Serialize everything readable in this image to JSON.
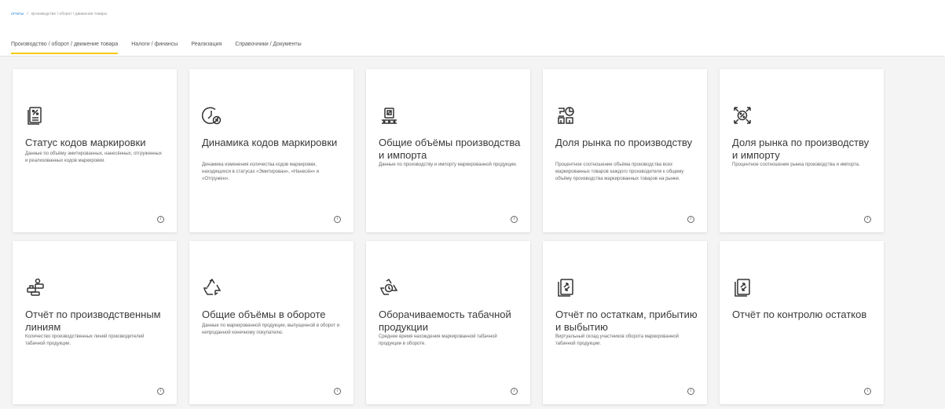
{
  "breadcrumb": {
    "root": "отчеты",
    "separator": "/",
    "path": "производство / оборот / движение товара"
  },
  "tabs": [
    {
      "label": "Производство / оборот / движение товара",
      "active": true
    },
    {
      "label": "Налоги / финансы",
      "active": false
    },
    {
      "label": "Реализация",
      "active": false
    },
    {
      "label": "Справочники / Документы",
      "active": false
    }
  ],
  "cards": [
    {
      "icon": "document-percent-icon",
      "title": "Статус кодов маркировки",
      "description": "Данные по объёму эмитированных, нанесённых, отгруженных и реализованных кодов маркировки."
    },
    {
      "icon": "clock-cancel-icon",
      "title": "Динамика кодов маркировки",
      "description": "Динамика изменения количества кодов маркировки, находящихся в статусах «Эмитирован», «Нанесён» и «Отгружен»."
    },
    {
      "icon": "conveyor-icon",
      "title": "Общие объёмы производства и импорта",
      "description": "Данные по производству и импорту маркированной продукции."
    },
    {
      "icon": "market-share-icon",
      "title": "Доля рынка по производству",
      "description": "Процентное соотношение объёма производства всех маркированных товаров каждого производителя к общему объёму производства маркированных товаров на рынке."
    },
    {
      "icon": "percent-arrows-icon",
      "title": "Доля рынка по производству и импорту",
      "description": "Процентное соотношение рынка производства и импорта."
    },
    {
      "icon": "production-lines-icon",
      "title": "Отчёт по производственным линиям",
      "description": "Количество производственных линий производителей табачной продукции."
    },
    {
      "icon": "recycle-icon",
      "title": "Общие объёмы в обороте",
      "description": "Данные по маркированной продукции, выпущенной в оборот и непроданной конечному покупателю."
    },
    {
      "icon": "recycle-clock-icon",
      "title": "Оборачиваемость табачной продукции",
      "description": "Среднее время нахождения маркированной табачной продукции в обороте."
    },
    {
      "icon": "document-exchange-icon",
      "title": "Отчёт по остаткам, прибытию и выбытию",
      "description": "Виртуальный склад участников оборота маркированной табачной продукции."
    },
    {
      "icon": "document-exchange-icon",
      "title": "Отчёт по контролю остатков",
      "description": ""
    }
  ],
  "info_glyph": "i"
}
